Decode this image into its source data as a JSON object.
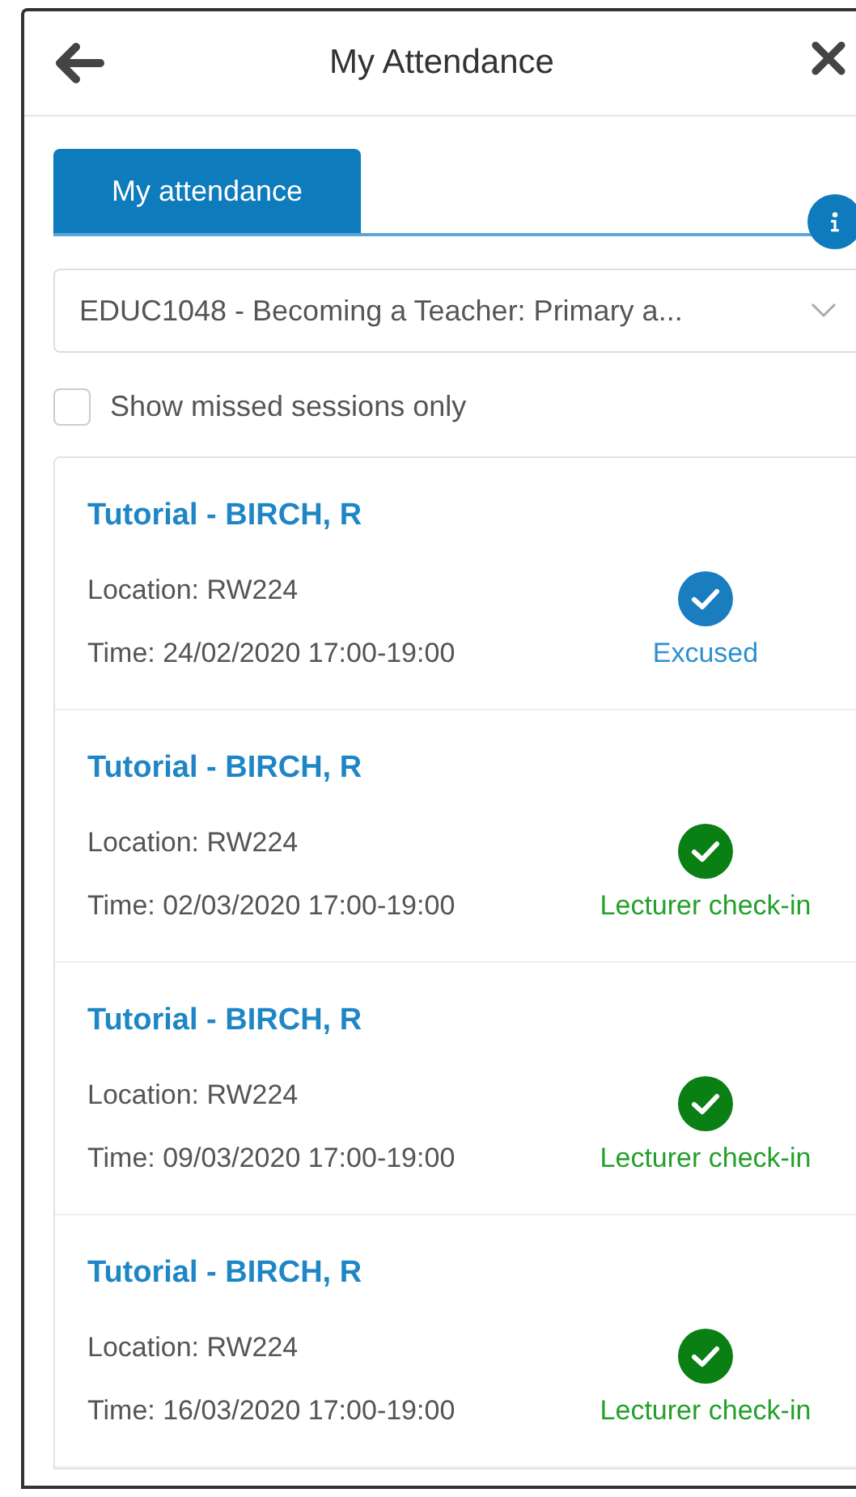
{
  "window": {
    "title": "My Attendance"
  },
  "tabs": [
    {
      "label": "My attendance",
      "selected": true
    }
  ],
  "module_select": {
    "value": "EDUC1048 - Becoming a Teacher: Primary a..."
  },
  "missed_only": {
    "label": "Show missed sessions only",
    "checked": false
  },
  "sessions": [
    {
      "title": "Tutorial - BIRCH, R",
      "location": "Location: RW224",
      "time": "Time: 24/02/2020 17:00-19:00",
      "status": {
        "kind": "excused",
        "label": "Excused"
      }
    },
    {
      "title": "Tutorial - BIRCH, R",
      "location": "Location: RW224",
      "time": "Time: 02/03/2020 17:00-19:00",
      "status": {
        "kind": "present",
        "label": "Lecturer check-in"
      }
    },
    {
      "title": "Tutorial - BIRCH, R",
      "location": "Location: RW224",
      "time": "Time: 09/03/2020 17:00-19:00",
      "status": {
        "kind": "present",
        "label": "Lecturer check-in"
      }
    },
    {
      "title": "Tutorial - BIRCH, R",
      "location": "Location: RW224",
      "time": "Time: 16/03/2020 17:00-19:00",
      "status": {
        "kind": "present",
        "label": "Lecturer check-in"
      }
    }
  ]
}
